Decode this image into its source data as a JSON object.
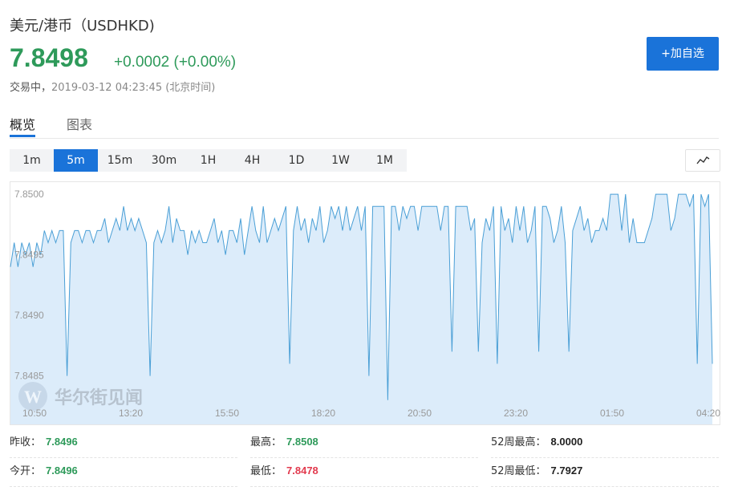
{
  "header": {
    "title": "美元/港币（USDHKD)",
    "price": "7.8498",
    "change": "+0.0002 (+0.00%)",
    "status_label": "交易中，",
    "timestamp": "2019-03-12 04:23:45 (北京时间)",
    "add_button": "+加自选"
  },
  "tabs": [
    "概览",
    "图表"
  ],
  "intervals": [
    "1m",
    "5m",
    "15m",
    "30m",
    "1H",
    "4H",
    "1D",
    "1W",
    "1M"
  ],
  "active_interval": "5m",
  "watermark": "华尔街见闻",
  "colors": {
    "accent": "#1a73d9",
    "up": "#2e9a5a",
    "down": "#e23a4e",
    "line": "#4a9fd6",
    "fill": "#dcecfa"
  },
  "chart_data": {
    "type": "area",
    "y_ticks": [
      "7.8500",
      "7.8495",
      "7.8490",
      "7.8485"
    ],
    "x_ticks": [
      "10:50",
      "13:20",
      "15:50",
      "18:20",
      "20:50",
      "23:20",
      "01:50",
      "04:20"
    ],
    "ylim": [
      7.8481,
      7.8501
    ],
    "values": [
      7.8494,
      7.8496,
      7.8494,
      7.8496,
      7.8495,
      7.8496,
      7.8494,
      7.8496,
      7.8495,
      7.8497,
      7.8496,
      7.8497,
      7.8496,
      7.8497,
      7.8497,
      7.8485,
      7.8496,
      7.8497,
      7.8497,
      7.8496,
      7.8497,
      7.8497,
      7.8496,
      7.8497,
      7.8497,
      7.8498,
      7.8496,
      7.8497,
      7.8498,
      7.8497,
      7.8499,
      7.8497,
      7.8498,
      7.8497,
      7.8498,
      7.8497,
      7.8496,
      7.8485,
      7.8496,
      7.8497,
      7.8496,
      7.8497,
      7.8499,
      7.8496,
      7.8498,
      7.8497,
      7.8497,
      7.8495,
      7.8497,
      7.8496,
      7.8497,
      7.8496,
      7.8496,
      7.8497,
      7.8498,
      7.8496,
      7.8497,
      7.8495,
      7.8497,
      7.8497,
      7.8496,
      7.8498,
      7.8495,
      7.8497,
      7.8499,
      7.8497,
      7.8496,
      7.8499,
      7.8496,
      7.8497,
      7.8498,
      7.8497,
      7.8498,
      7.8499,
      7.8486,
      7.8497,
      7.8499,
      7.8497,
      7.8498,
      7.8496,
      7.8498,
      7.8497,
      7.8499,
      7.8496,
      7.8497,
      7.8499,
      7.8498,
      7.8499,
      7.8497,
      7.8499,
      7.8497,
      7.8498,
      7.8499,
      7.8497,
      7.8499,
      7.8485,
      7.8499,
      7.8499,
      7.8499,
      7.8499,
      7.8483,
      7.8499,
      7.8499,
      7.8497,
      7.8499,
      7.8498,
      7.8499,
      7.8499,
      7.8497,
      7.8499,
      7.8499,
      7.8499,
      7.8499,
      7.8499,
      7.8497,
      7.8499,
      7.8499,
      7.8487,
      7.8499,
      7.8499,
      7.8499,
      7.8499,
      7.8497,
      7.8498,
      7.8487,
      7.8496,
      7.8498,
      7.8497,
      7.8499,
      7.8486,
      7.8499,
      7.8497,
      7.8498,
      7.8496,
      7.8499,
      7.8497,
      7.8499,
      7.8496,
      7.8497,
      7.8499,
      7.8487,
      7.8499,
      7.8499,
      7.8498,
      7.8496,
      7.8497,
      7.8499,
      7.8496,
      7.8487,
      7.8497,
      7.8498,
      7.8499,
      7.8497,
      7.8498,
      7.8496,
      7.8497,
      7.8497,
      7.8498,
      7.8497,
      7.85,
      7.85,
      7.85,
      7.8497,
      7.85,
      7.8496,
      7.8498,
      7.8496,
      7.8496,
      7.8496,
      7.8497,
      7.8498,
      7.85,
      7.85,
      7.85,
      7.85,
      7.8497,
      7.8498,
      7.85,
      7.85,
      7.85,
      7.8499,
      7.85,
      7.8486,
      7.85,
      7.8499,
      7.85,
      7.8486
    ]
  },
  "stats": [
    {
      "label": "昨收：",
      "value": "7.8496",
      "tone": "green"
    },
    {
      "label": "最高：",
      "value": "7.8508",
      "tone": "green"
    },
    {
      "label": "52周最高：",
      "value": "8.0000",
      "tone": "black"
    },
    {
      "label": "今开：",
      "value": "7.8496",
      "tone": "green"
    },
    {
      "label": "最低：",
      "value": "7.8478",
      "tone": "red"
    },
    {
      "label": "52周最低：",
      "value": "7.7927",
      "tone": "black"
    }
  ]
}
